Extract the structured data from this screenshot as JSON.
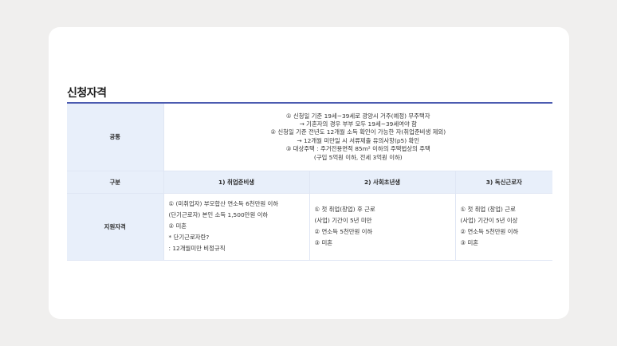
{
  "section": {
    "title": "신청자격"
  },
  "table": {
    "common_label": "공통",
    "common_lines": [
      "① 신청일 기준 19세~39세로 광양시 거주(예정) 무주택자",
      "→ 기혼자의 경우 부부 모두 19세~39세여야 함",
      "② 신청일 기준 전년도 12개월 소득 확인이 가능한 자(취업준비생 제외)",
      "→ 12개월 미만일 시 서류제출 유의사항(p5) 확인",
      "③ 대상주택 : 주거전용면적 85m² 이하의 주택법상의 주택",
      "(구입 5억원 이하, 전세 3억원 이하)"
    ],
    "header": {
      "category": "구분",
      "col1": "1) 취업준비생",
      "col2": "2) 사회초년생",
      "col3": "3) 독신근로자"
    },
    "support_label": "지원자격",
    "col1_lines": [
      "① (미취업자) 부모합산 연소득 6천만원 이하",
      "(단기근로자) 본인 소득 1,500만원 이하",
      "② 미혼",
      "* 단기근로자란?",
      " : 12개월미만 비정규직"
    ],
    "col2_lines": [
      "① 첫 취업(창업) 후 근로",
      "(사업) 기간이 5년 미만",
      "② 연소득 5천만원 이하",
      "③ 미혼"
    ],
    "col3_lines": [
      "① 첫 취업 (창업) 근로",
      "(사업) 기간이 5년 이상",
      "② 연소득 5천만원 이하",
      "③ 미혼"
    ]
  }
}
